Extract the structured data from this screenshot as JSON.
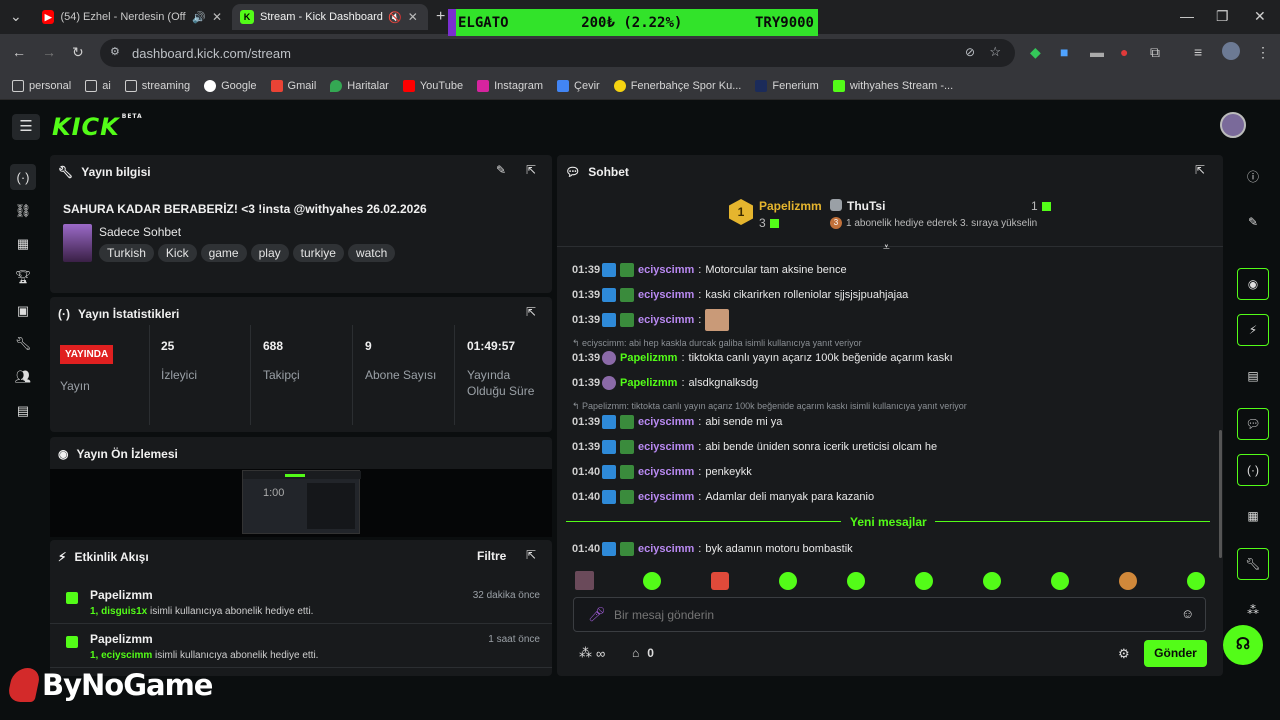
{
  "browser": {
    "tabs": [
      {
        "title": "(54) Ezhel - Nerdesin (Officia",
        "icon": "youtube-icon"
      },
      {
        "title": "Stream - Kick Dashboard",
        "icon": "kick-icon"
      }
    ],
    "ticker": {
      "left": "ELGATO",
      "mid": "200₺ (2.22%)",
      "right": "TRY9000"
    },
    "url": "dashboard.kick.com/stream",
    "bookmarks": [
      "personal",
      "ai",
      "streaming",
      "Google",
      "Gmail",
      "Haritalar",
      "YouTube",
      "Instagram",
      "Çevir",
      "Fenerbahçe Spor Ku...",
      "Fenerium",
      "withyahes Stream -..."
    ]
  },
  "colors": {
    "accent": "#53fc18",
    "panel": "#181a1c",
    "bg": "#0b0e0f",
    "live_red": "#e02020",
    "username_purple": "#b989f2"
  },
  "kick": {
    "logo": "KICK",
    "beta": "BETA"
  },
  "stream_info": {
    "title": "Yayın bilgisi",
    "stream_title": "SAHURA KADAR BERABERİZ! <3 !insta @withyahes 26.02.2026",
    "category": "Sadece Sohbet",
    "tags": [
      "Turkish",
      "Kick",
      "game",
      "play",
      "turkiye",
      "watch"
    ]
  },
  "stats": {
    "title": "Yayın İstatistikleri",
    "live_badge": "YAYINDA",
    "live_label": "Yayın",
    "items": [
      {
        "value": "25",
        "label": "İzleyici"
      },
      {
        "value": "688",
        "label": "Takipçi"
      },
      {
        "value": "9",
        "label": "Abone Sayısı"
      },
      {
        "value": "01:49:57",
        "label": "Yayında Olduğu Süre"
      }
    ]
  },
  "preview": {
    "title": "Yayın Ön İzlemesi",
    "thumb_time": "1:00"
  },
  "activity": {
    "title": "Etkinlik Akışı",
    "filter": "Filtre",
    "events": [
      {
        "name": "Papelizmm",
        "detail_bold": "1, disguis1x",
        "detail": "isimli kullanıcıya abonelik hediye etti.",
        "time": "32 dakika önce"
      },
      {
        "name": "Papelizmm",
        "detail_bold": "1, eciyscimm",
        "detail": "isimli kullanıcıya abonelik hediye etti.",
        "time": "1 saat önce"
      }
    ]
  },
  "chat": {
    "title": "Sohbet",
    "leaderboard": {
      "first": {
        "rank": "1",
        "name": "Papelizmm",
        "count": "3"
      },
      "second": {
        "name": "ThuTsi",
        "count": "1",
        "rank_badge": "3",
        "note": "1 abonelik hediye ederek 3. sıraya yükselin"
      }
    },
    "messages": [
      {
        "time": "01:39",
        "user": "eciyscimm",
        "text": "Motorcular tam aksine bence"
      },
      {
        "time": "01:39",
        "user": "eciyscimm",
        "text": "kaski cikarirken rolleniolar sjjsjsjpuahjajaa"
      },
      {
        "time": "01:39",
        "user": "eciyscimm",
        "text": ""
      },
      {
        "time": "01:39",
        "user": "Papelizmm",
        "text": "tiktokta canlı yayın açarız 100k beğenide açarım kaskı",
        "reply": "eciyscimm: abi hep kaskla durcak galiba isimli kullanıcıya yanıt veriyor"
      },
      {
        "time": "01:39",
        "user": "Papelizmm",
        "text": "alsdkgnalksdg"
      },
      {
        "time": "01:39",
        "user": "eciyscimm",
        "text": "abi sende mi ya",
        "reply": "Papelizmm: tiktokta canlı yayın açarız 100k beğenide açarım kaskı isimli kullanıcıya yanıt veriyor"
      },
      {
        "time": "01:39",
        "user": "eciyscimm",
        "text": "abi bende üniden sonra icerik ureticisi olcam he"
      },
      {
        "time": "01:40",
        "user": "eciyscimm",
        "text": "penkeykk"
      },
      {
        "time": "01:40",
        "user": "eciyscimm",
        "text": "Adamlar deli manyak para kazanio"
      },
      {
        "time": "01:40",
        "user": "eciyscimm",
        "text": "byk adamın motoru bombastik"
      }
    ],
    "new_messages": "Yeni mesajlar",
    "input_placeholder": "Bir mesaj gönderin",
    "infinity": "∞",
    "store_count": "0",
    "send": "Gönder"
  },
  "watermark": "ByNoGame"
}
